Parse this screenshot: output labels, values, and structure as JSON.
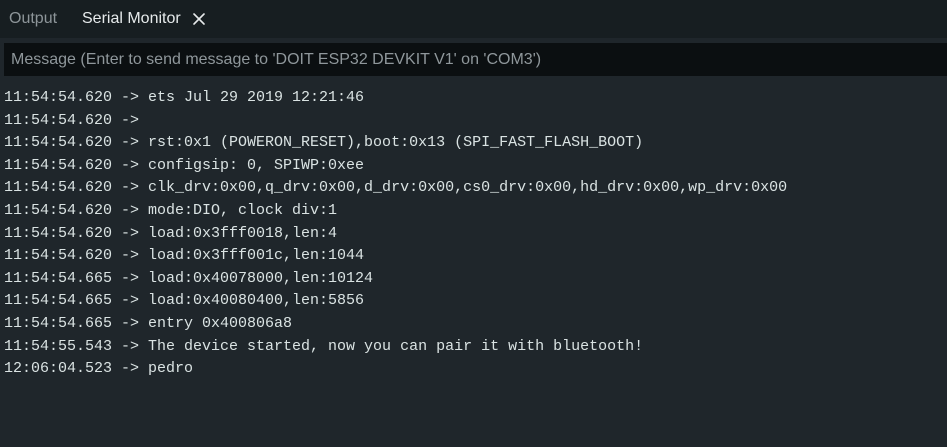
{
  "tabs": {
    "output_label": "Output",
    "serial_monitor_label": "Serial Monitor",
    "close_icon": "close-icon"
  },
  "message_input": {
    "placeholder": "Message (Enter to send message to 'DOIT ESP32 DEVKIT V1' on 'COM3')",
    "value": ""
  },
  "colors": {
    "background": "#1f262b",
    "tabbar_background": "#171e21",
    "input_background": "#0b0f11",
    "text": "#dae3e3",
    "inactive_tab": "#8d9599"
  },
  "log": [
    "11:54:54.620 -> ets Jul 29 2019 12:21:46",
    "11:54:54.620 -> ",
    "11:54:54.620 -> rst:0x1 (POWERON_RESET),boot:0x13 (SPI_FAST_FLASH_BOOT)",
    "11:54:54.620 -> configsip: 0, SPIWP:0xee",
    "11:54:54.620 -> clk_drv:0x00,q_drv:0x00,d_drv:0x00,cs0_drv:0x00,hd_drv:0x00,wp_drv:0x00",
    "11:54:54.620 -> mode:DIO, clock div:1",
    "11:54:54.620 -> load:0x3fff0018,len:4",
    "11:54:54.620 -> load:0x3fff001c,len:1044",
    "11:54:54.665 -> load:0x40078000,len:10124",
    "11:54:54.665 -> load:0x40080400,len:5856",
    "11:54:54.665 -> entry 0x400806a8",
    "11:54:55.543 -> The device started, now you can pair it with bluetooth!",
    "12:06:04.523 -> pedro"
  ]
}
